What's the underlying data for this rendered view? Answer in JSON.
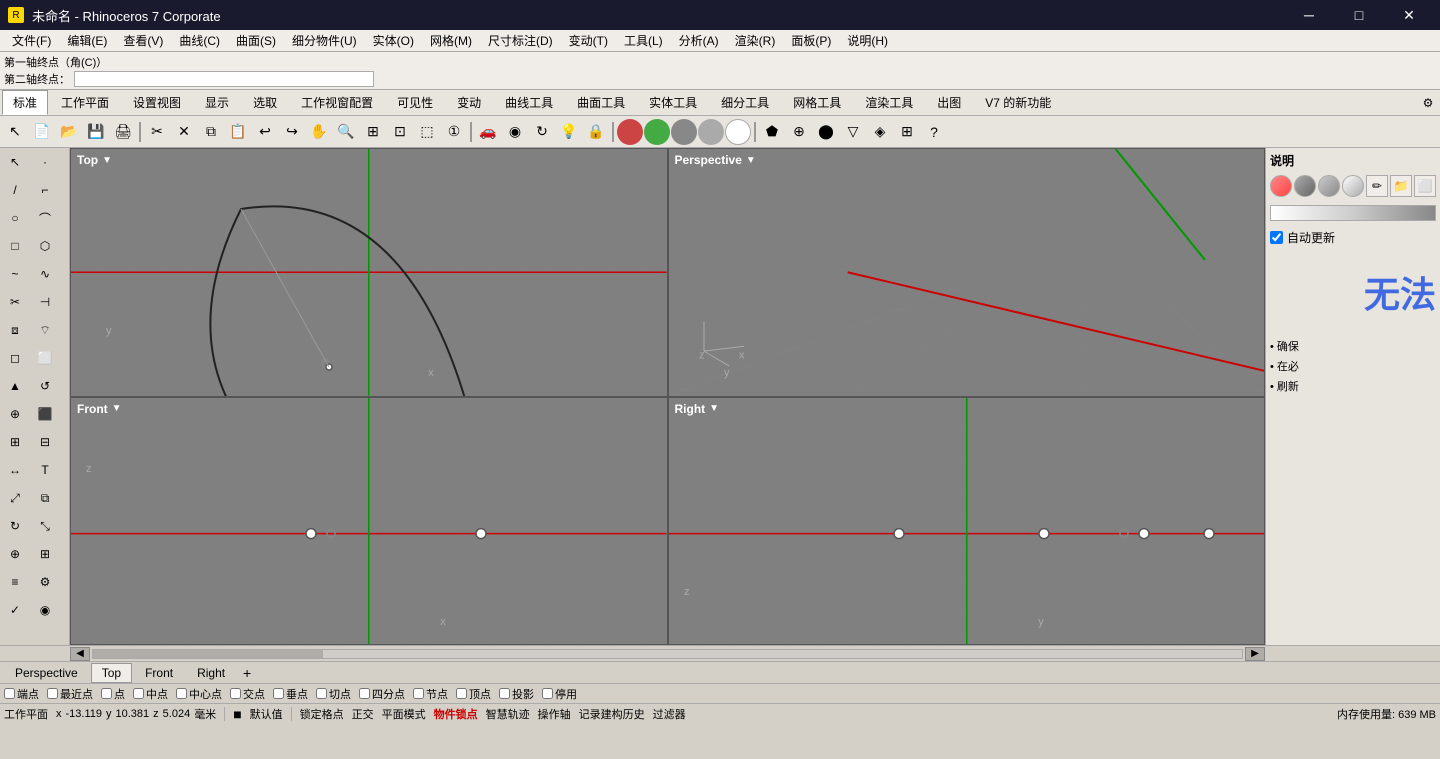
{
  "titlebar": {
    "icon": "R",
    "title": "未命名 - Rhinoceros 7 Corporate",
    "min_btn": "─",
    "max_btn": "□",
    "close_btn": "✕"
  },
  "menubar": {
    "items": [
      "文件(F)",
      "编辑(E)",
      "查看(V)",
      "曲线(C)",
      "曲面(S)",
      "细分物件(U)",
      "实体(O)",
      "网格(M)",
      "尺寸标注(D)",
      "变动(T)",
      "工具(L)",
      "分析(A)",
      "渲染(R)",
      "面板(P)",
      "说明(H)"
    ]
  },
  "cmdarea": {
    "line1": "第一轴终点（角(C)）",
    "line2": "第二轴终点："
  },
  "toolbar_tabs": {
    "tabs": [
      "标准",
      "工作平面",
      "设置视图",
      "显示",
      "选取",
      "工作视窗配置",
      "可见性",
      "变动",
      "曲线工具",
      "曲面工具",
      "实体工具",
      "细分工具",
      "网格工具",
      "渲染工具",
      "出图",
      "V7 的新功能"
    ],
    "active": "标准"
  },
  "viewports": {
    "top_left": {
      "label": "Top",
      "arrow": "▼"
    },
    "top_right": {
      "label": "Perspective",
      "arrow": "▼"
    },
    "bottom_left": {
      "label": "Front",
      "arrow": "▼"
    },
    "bottom_right": {
      "label": "Right",
      "arrow": "▼"
    }
  },
  "vp_tabs": {
    "tabs": [
      "Perspective",
      "Top",
      "Front",
      "Right"
    ],
    "active": "Top",
    "add": "+"
  },
  "right_panel": {
    "title": "说明",
    "big_text": "无法",
    "checkbox_label": "✓自动更新",
    "bullets": [
      "• 确保",
      "• 在必",
      "• 刷新"
    ]
  },
  "snapbar": {
    "items": [
      "端点",
      "最近点",
      "点",
      "中点",
      "中心点",
      "交点",
      "垂点",
      "切点",
      "四分点",
      "节点",
      "顶点",
      "投影",
      "停用"
    ]
  },
  "statusbar": {
    "workplane": "工作平面",
    "x_label": "x",
    "x_value": "-13.119",
    "y_label": "y",
    "y_value": "10.381",
    "z_label": "z",
    "z_value": "5.024",
    "unit": "毫米",
    "color_swatch": "■",
    "default": "默认值",
    "lock_grid": "锁定格点",
    "ortho": "正交",
    "planar": "平面模式",
    "obj_lock": "物件锁点",
    "smart": "智慧轨迹",
    "op_axis": "操作轴",
    "record": "记录建构历史",
    "filter": "过滤器",
    "memory": "内存使用量: 639 MB"
  }
}
